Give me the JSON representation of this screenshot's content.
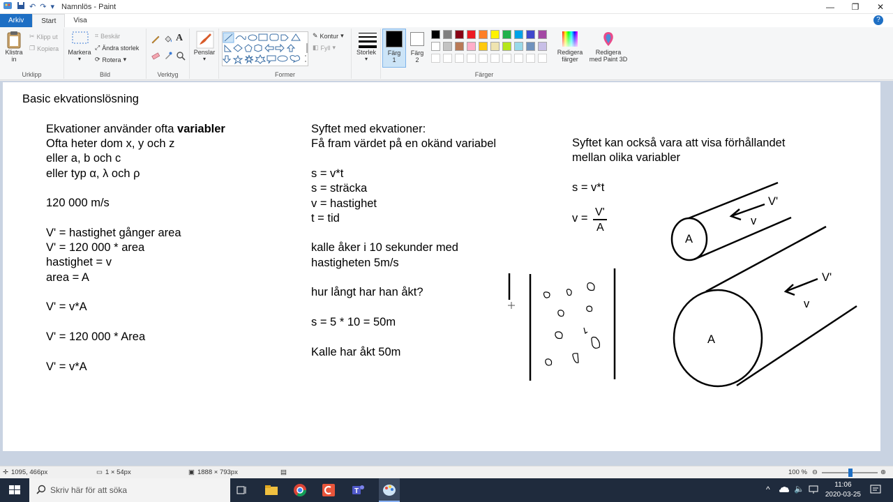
{
  "window": {
    "title": "Namnlös - Paint",
    "minimize": "—",
    "maximize": "❐",
    "close": "✕"
  },
  "tabs": [
    {
      "label": "Arkiv"
    },
    {
      "label": "Start"
    },
    {
      "label": "Visa"
    }
  ],
  "ribbon": {
    "clipboard": {
      "label": "Urklipp",
      "paste": "Klistra",
      "paste2": "in",
      "cut": "Klipp ut",
      "copy": "Kopiera"
    },
    "image": {
      "label": "Bild",
      "select": "Markera",
      "crop": "Beskär",
      "resize": "Ändra storlek",
      "rotate": "Rotera"
    },
    "tools": {
      "label": "Verktyg"
    },
    "brushes": {
      "label": "Penslar"
    },
    "shapes": {
      "label": "Former",
      "outline": "Kontur",
      "fill": "Fyll"
    },
    "size": {
      "label": "Storlek"
    },
    "color1": {
      "label": "Färg",
      "label2": "1"
    },
    "color2": {
      "label": "Färg",
      "label2": "2"
    },
    "colors": {
      "label": "Färger",
      "row1": [
        "#000000",
        "#7f7f7f",
        "#880015",
        "#ed1c24",
        "#ff7f27",
        "#fff200",
        "#22b14c",
        "#00a2e8",
        "#3f48cc",
        "#a349a4"
      ],
      "row2": [
        "#ffffff",
        "#c3c3c3",
        "#b97a57",
        "#ffaec9",
        "#ffc90e",
        "#efe4b0",
        "#b5e61d",
        "#99d9ea",
        "#7092be",
        "#c8bfe7"
      ]
    },
    "edit_colors": {
      "label": "Redigera",
      "label2": "färger"
    },
    "paint3d": {
      "label": "Redigera",
      "label2": "med Paint 3D"
    }
  },
  "canvas": {
    "title": "Basic ekvationslösning",
    "col1": {
      "line1_prefix": "Ekvationer använder ofta ",
      "line1_bold": "variabler",
      "lines": [
        "Ofta heter dom x, y och z",
        "eller a, b och c",
        "eller typ α, λ och ρ",
        "",
        "120 000 m/s",
        "",
        "V' = hastighet gånger area",
        "V' = 120 000 * area",
        "hastighet = v",
        "area = A",
        "",
        "V' = v*A",
        "",
        "V' = 120 000 * Area",
        "",
        "V' = v*A"
      ]
    },
    "col2": {
      "lines": [
        "Syftet med ekvationer:",
        "Få fram värdet på en okänd variabel",
        "",
        "s = v*t",
        "s = sträcka",
        "v = hastighet",
        "t = tid",
        "",
        "kalle åker i 10 sekunder med",
        "hastigheten 5m/s",
        "",
        "hur långt har han åkt?",
        "",
        "s = 5 * 10 = 50m",
        "",
        "Kalle har åkt 50m"
      ]
    },
    "col3": {
      "lines": [
        "Syftet kan också vara att visa förhållandet",
        "mellan olika variabler",
        "",
        "s = v*t"
      ],
      "v_eq": "v =",
      "frac_num": "V'",
      "frac_den": "A"
    },
    "drawing": {
      "small_a": "A",
      "small_vprime": "V'",
      "small_v": "v",
      "big_a": "A",
      "big_vprime": "V'",
      "big_v": "v"
    }
  },
  "statusbar": {
    "cursor": "1095, 466px",
    "selection": "1 × 54px",
    "canvas_size": "1888 × 793px",
    "zoom": "100 %"
  },
  "taskbar": {
    "search_placeholder": "Skriv här för att söka",
    "time": "11:06",
    "date": "2020-03-25"
  }
}
